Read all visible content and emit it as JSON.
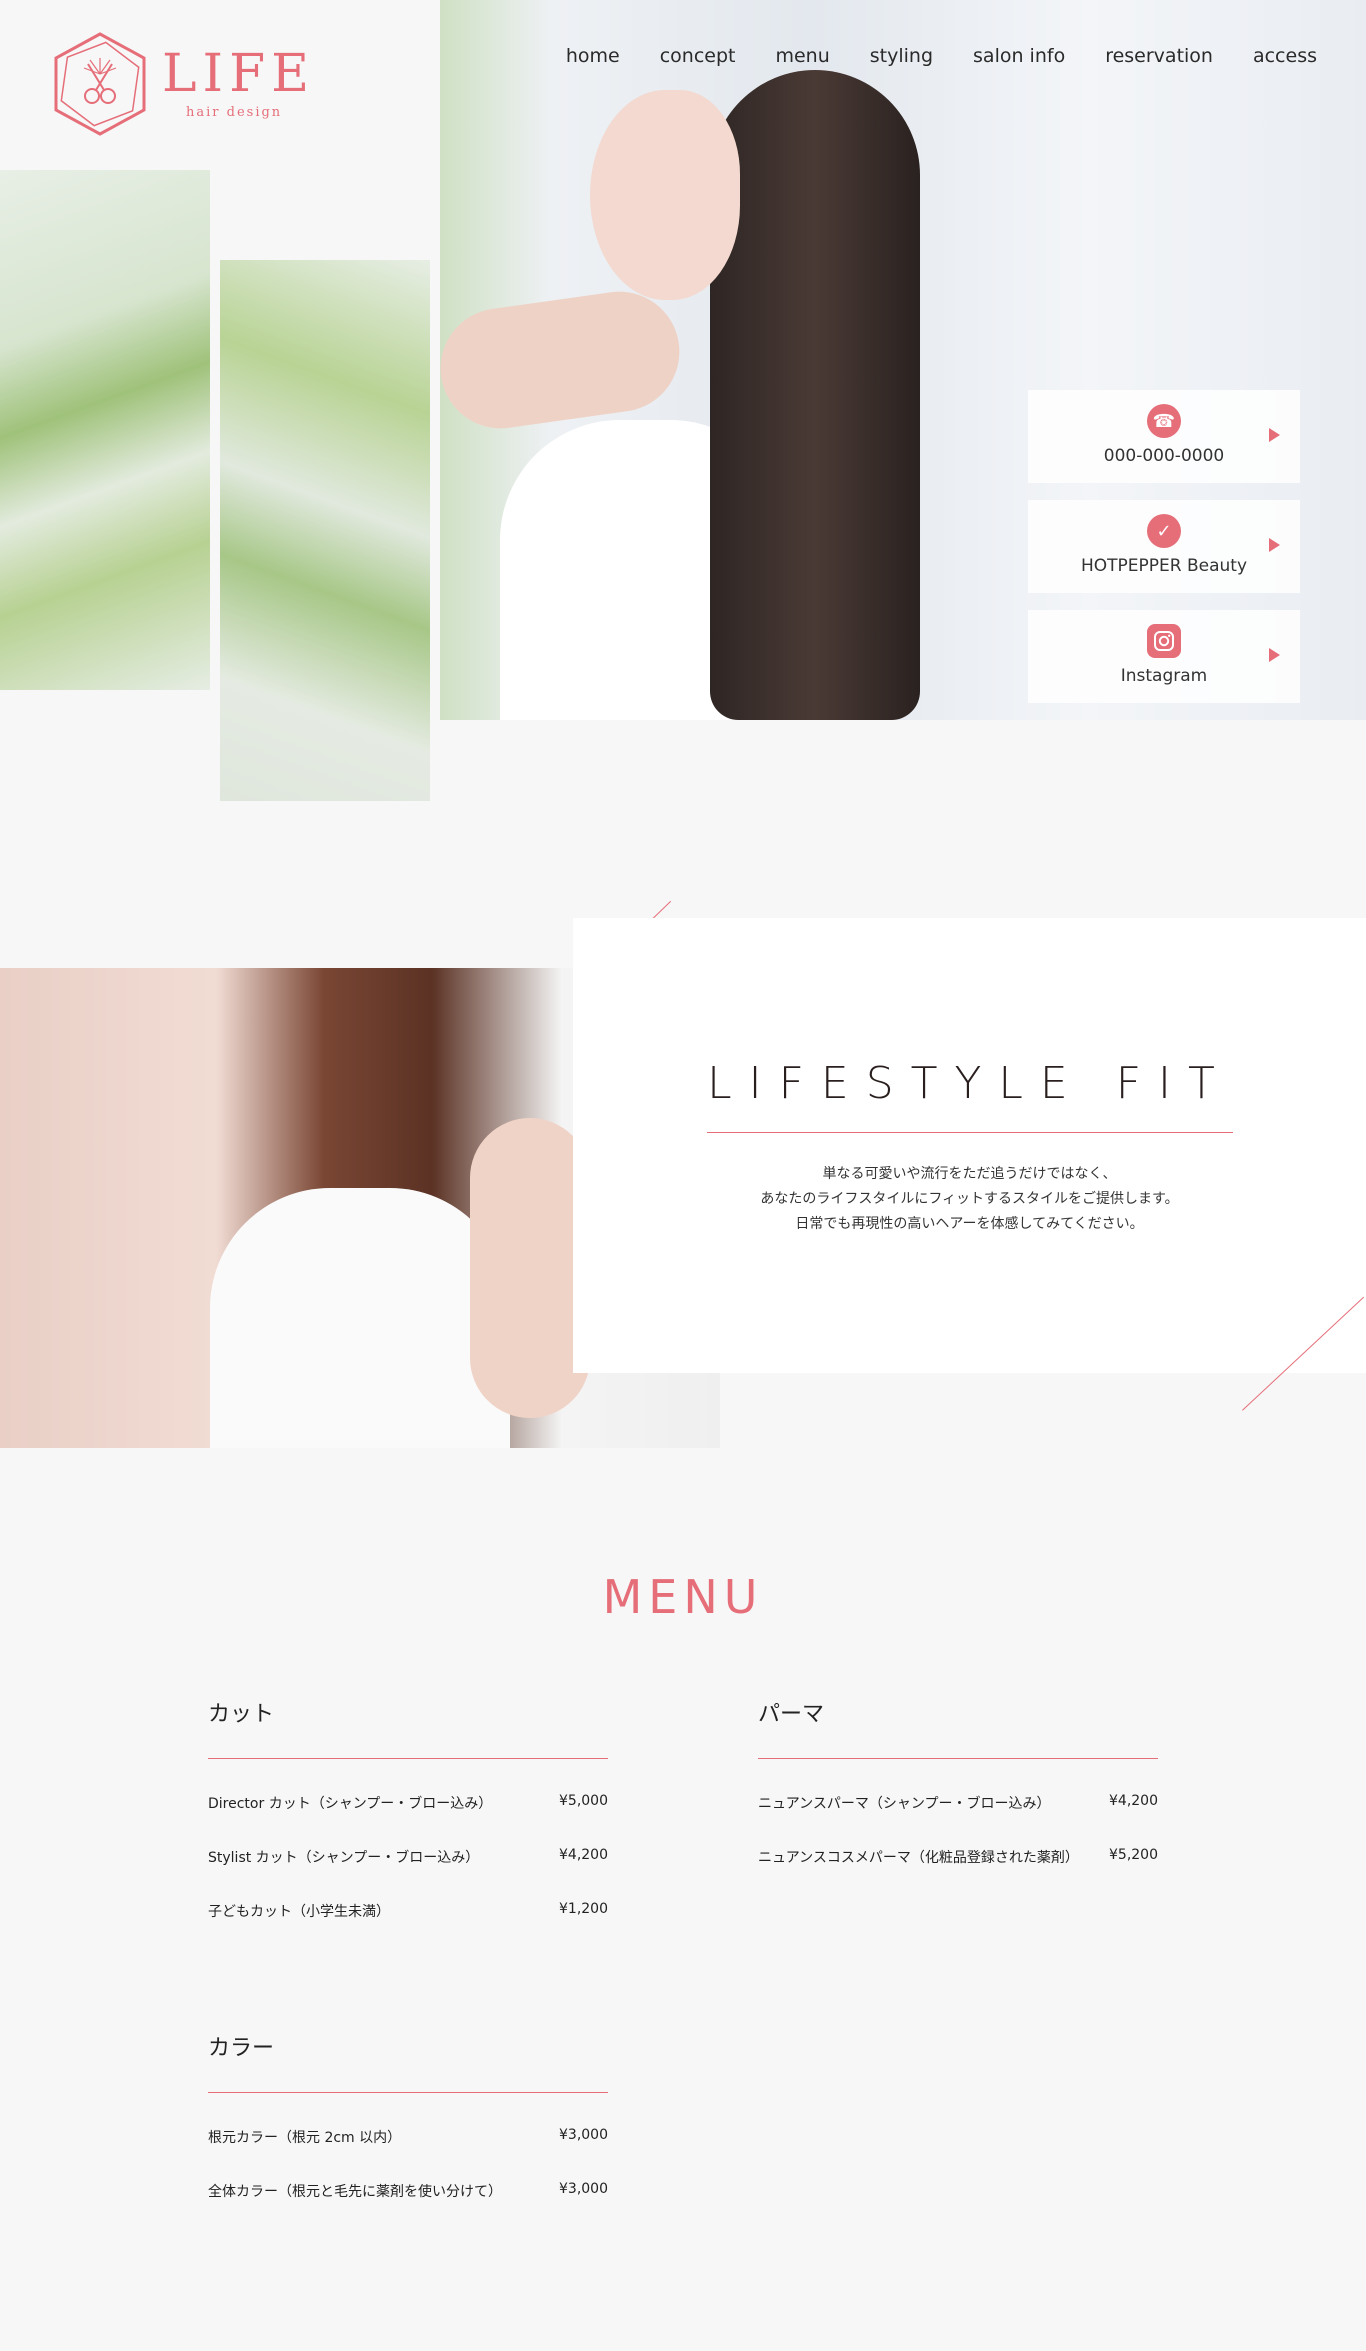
{
  "brand": {
    "name": "LIFE",
    "sub": "hair design"
  },
  "nav": [
    "home",
    "concept",
    "menu",
    "styling",
    "salon info",
    "reservation",
    "access"
  ],
  "contacts": [
    {
      "icon": "phone-icon",
      "label": "000-000-0000"
    },
    {
      "icon": "check-circle-icon",
      "label": "HOTPEPPER Beauty"
    },
    {
      "icon": "instagram-icon",
      "label": "Instagram"
    }
  ],
  "concept": {
    "title": "LIFESTYLE FIT",
    "lines": [
      "単なる可愛いや流行をただ追うだけではなく、",
      "あなたのライフスタイルにフィットするスタイルをご提供します。",
      "日常でも再現性の高いヘアーを体感してみてください。"
    ]
  },
  "menu": {
    "title": "MENU",
    "cut": {
      "heading": "カット",
      "items": [
        {
          "name": "Director カット（シャンプー・ブロー込み）",
          "price": "¥5,000"
        },
        {
          "name": "Stylist カット（シャンプー・ブロー込み）",
          "price": "¥4,200"
        },
        {
          "name": "子どもカット（小学生未満）",
          "price": "¥1,200"
        }
      ]
    },
    "perm": {
      "heading": "パーマ",
      "items": [
        {
          "name": "ニュアンスパーマ（シャンプー・ブロー込み）",
          "price": "¥4,200"
        },
        {
          "name": "ニュアンスコスメパーマ（化粧品登録された薬剤）",
          "price": "¥5,200"
        }
      ]
    },
    "color": {
      "heading": "カラー",
      "items": [
        {
          "name": "根元カラー（根元 2cm 以内）",
          "price": "¥3,000"
        },
        {
          "name": "全体カラー（根元と毛先に薬剤を使い分けて）",
          "price": "¥3,000"
        }
      ]
    }
  },
  "colors": {
    "accent": "#e56e79",
    "background": "#f7f7f7"
  }
}
